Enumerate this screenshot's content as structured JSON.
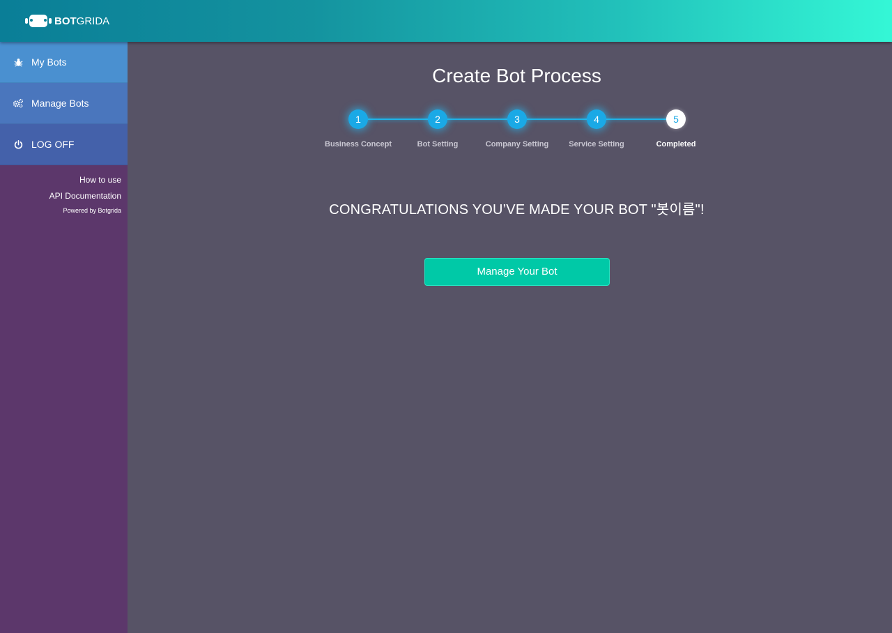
{
  "brand": {
    "name_bold": "BOT",
    "name_rest": "GRIDA"
  },
  "sidebar": {
    "items": [
      {
        "label": "My Bots",
        "icon": "bug-icon"
      },
      {
        "label": "Manage Bots",
        "icon": "gears-icon"
      },
      {
        "label": "LOG OFF",
        "icon": "power-icon"
      }
    ],
    "links": [
      "How to use",
      "API Documentation"
    ],
    "powered_by": "Powered by Botgrida"
  },
  "main": {
    "title": "Create Bot Process",
    "steps": [
      {
        "num": "1",
        "label": "Business Concept"
      },
      {
        "num": "2",
        "label": "Bot Setting"
      },
      {
        "num": "3",
        "label": "Company Setting"
      },
      {
        "num": "4",
        "label": "Service Setting"
      },
      {
        "num": "5",
        "label": "Completed"
      }
    ],
    "current_step": 5,
    "message": "CONGRATULATIONS YOU’VE MADE YOUR BOT \"봇이름\"!",
    "cta_label": "Manage Your Bot"
  },
  "colors": {
    "accent_teal": "#00c9a7",
    "step_blue": "#1aa9e6",
    "sidebar_bg": "#5c376b",
    "main_bg": "#575366"
  }
}
